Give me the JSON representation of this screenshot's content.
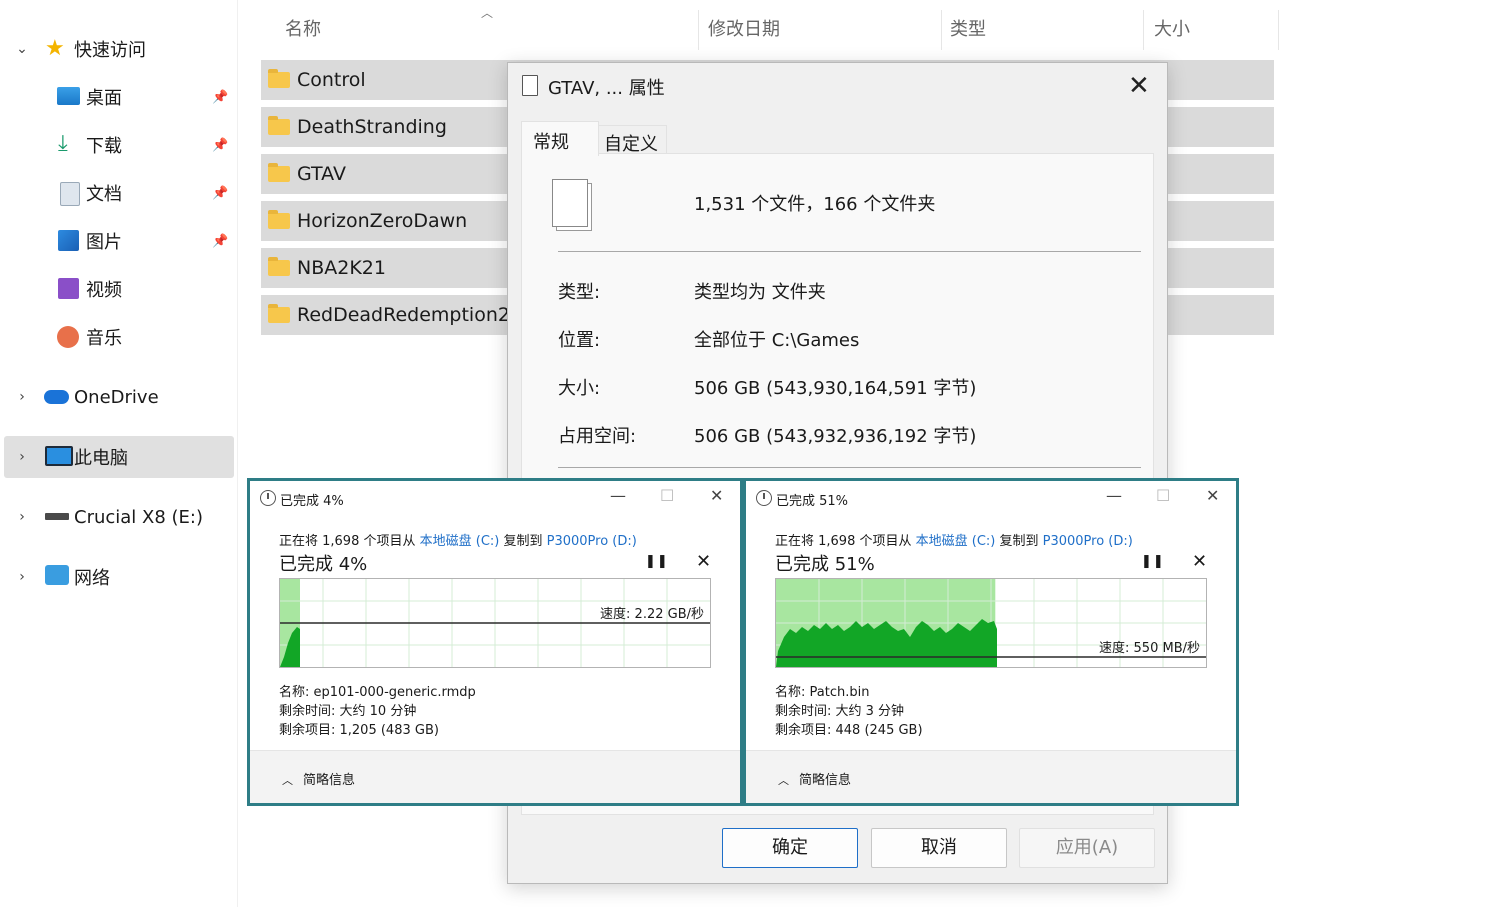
{
  "sidebar": {
    "quick_access": "快速访问",
    "items": [
      {
        "label": "桌面"
      },
      {
        "label": "下载"
      },
      {
        "label": "文档"
      },
      {
        "label": "图片"
      },
      {
        "label": "视频"
      },
      {
        "label": "音乐"
      }
    ],
    "onedrive": "OneDrive",
    "this_pc": "此电脑",
    "drive": "Crucial X8 (E:)",
    "network": "网络"
  },
  "file_list": {
    "columns": [
      "名称",
      "修改日期",
      "类型",
      "大小"
    ],
    "rows": [
      "Control",
      "DeathStranding",
      "GTAV",
      "HorizonZeroDawn",
      "NBA2K21",
      "RedDeadRedemption2"
    ]
  },
  "properties_dialog": {
    "title": "GTAV, ... 属性",
    "tabs": [
      "常规",
      "自定义"
    ],
    "summary": "1,531 个文件，166 个文件夹",
    "props": [
      {
        "label": "类型:",
        "value": "类型均为 文件夹"
      },
      {
        "label": "位置:",
        "value": "全部位于 C:\\Games"
      },
      {
        "label": "大小:",
        "value": "506 GB (543,930,164,591 字节)"
      },
      {
        "label": "占用空间:",
        "value": "506 GB (543,932,936,192 字节)"
      }
    ],
    "buttons": {
      "ok": "确定",
      "cancel": "取消",
      "apply": "应用(A)"
    }
  },
  "copy_dialogs": [
    {
      "title": "已完成 4%",
      "prefix": "正在将 1,698 个项目从 ",
      "source": "本地磁盘 (C:)",
      "middle": " 复制到 ",
      "dest": "P3000Pro (D:)",
      "heading": "已完成 4%",
      "speed": "速度: 2.22 GB/秒",
      "progress": 0.04,
      "name": "名称: ep101-000-generic.rmdp",
      "time_left": "剩余时间: 大约 10 分钟",
      "items_left": "剩余项目: 1,205 (483 GB)",
      "more_info": "简略信息"
    },
    {
      "title": "已完成 51%",
      "prefix": "正在将 1,698 个项目从 ",
      "source": "本地磁盘 (C:)",
      "middle": " 复制到 ",
      "dest": "P3000Pro (D:)",
      "heading": "已完成 51%",
      "speed": "速度: 550 MB/秒",
      "progress": 0.51,
      "name": "名称: Patch.bin",
      "time_left": "剩余时间: 大约 3 分钟",
      "items_left": "剩余项目: 448 (245 GB)",
      "more_info": "简略信息"
    }
  ],
  "colors": {
    "accent": "#1f6fc8",
    "border_teal": "#2e7d86",
    "graph_fill": "#a8e6a0",
    "graph_line": "#00b020"
  }
}
